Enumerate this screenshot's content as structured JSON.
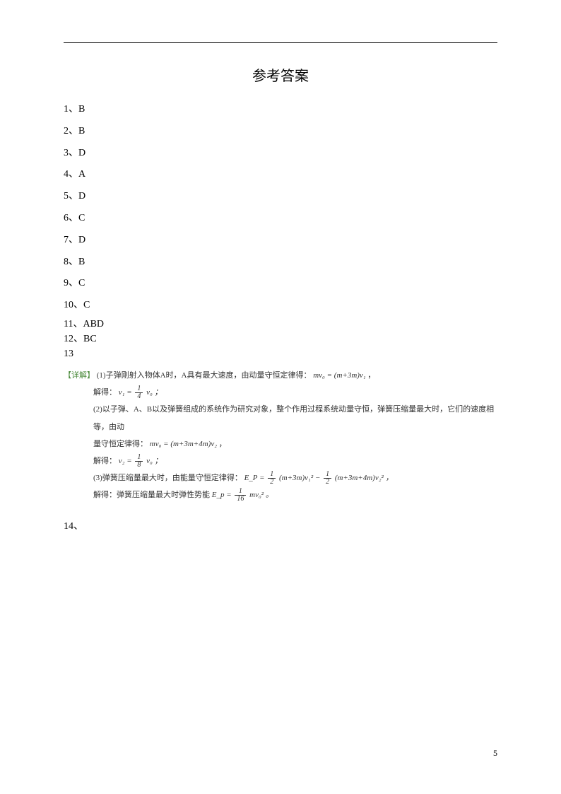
{
  "title": "参考答案",
  "answers": [
    {
      "num": "1、",
      "val": "B"
    },
    {
      "num": "2、",
      "val": "B"
    },
    {
      "num": "3、",
      "val": "D"
    },
    {
      "num": "4、",
      "val": "A"
    },
    {
      "num": "5、",
      "val": "D"
    },
    {
      "num": "6、",
      "val": "C"
    },
    {
      "num": "7、",
      "val": "D"
    },
    {
      "num": "8、",
      "val": "B"
    },
    {
      "num": "9、",
      "val": "C"
    },
    {
      "num": "10、",
      "val": "C"
    },
    {
      "num": "11、",
      "val": "ABD"
    },
    {
      "num": "12、",
      "val": "BC"
    },
    {
      "num": "13",
      "val": ""
    }
  ],
  "detail": {
    "label": "【详解】",
    "part1_text": "(1)子弹刚射入物体A时，A具有最大速度，由动量守恒定律得：",
    "part1_formula": "mv₀ = (m+3m)v₁",
    "solve1_label": "解得：",
    "solve1_var": "v₁ =",
    "solve1_frac_num": "1",
    "solve1_frac_den": "4",
    "solve1_tail": "v₀ ；",
    "part2_text": "(2)以子弹、A、B以及弹簧组成的系统作为研究对象，整个作用过程系统动量守恒，弹簧压缩量最大时，它们的速度相等，由动",
    "part2_cont": "量守恒定律得：",
    "part2_formula": "mv₀ = (m+3m+4m)v₂",
    "solve2_label": "解得：",
    "solve2_var": "v₂ =",
    "solve2_frac_num": "1",
    "solve2_frac_den": "8",
    "solve2_tail": "v₀ ；",
    "part3_text": "(3)弹簧压缩量最大时，由能量守恒定律得：",
    "part3_var": "E_P =",
    "part3_f1_num": "1",
    "part3_f1_den": "2",
    "part3_mid1": "(m+3m)v₁² −",
    "part3_f2_num": "1",
    "part3_f2_den": "2",
    "part3_mid2": "(m+3m+4m)v₂² ，",
    "solve3_label": "解得：弹簧压缩量最大时弹性势能",
    "solve3_var": "E_p =",
    "solve3_frac_num": "1",
    "solve3_frac_den": "16",
    "solve3_tail": "mv₀² 。"
  },
  "q14": "14、",
  "pageNumber": "5"
}
